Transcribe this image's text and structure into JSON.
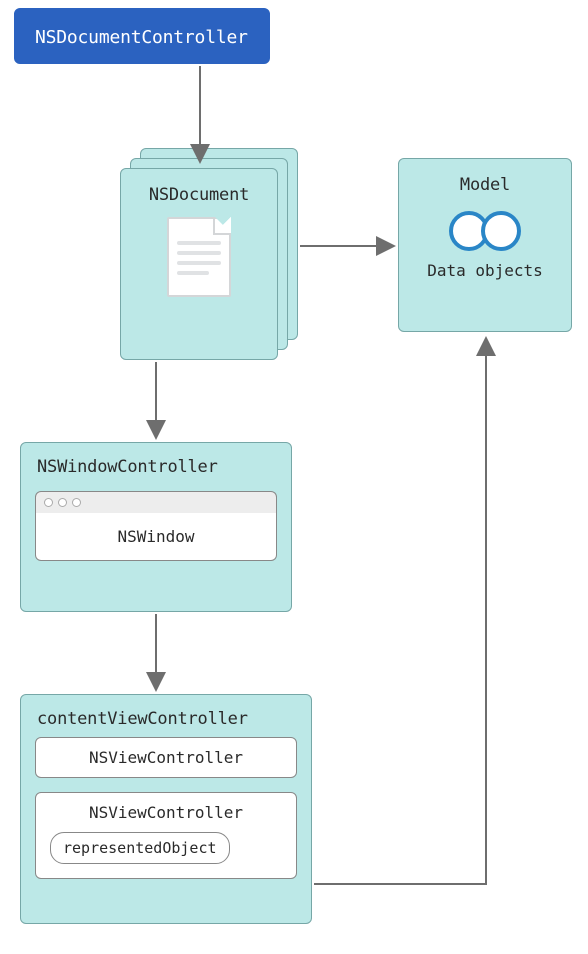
{
  "nodes": {
    "doc_controller": "NSDocumentController",
    "document": "NSDocument",
    "model_title": "Model",
    "model_caption": "Data objects",
    "window_controller": "NSWindowController",
    "window": "NSWindow",
    "content_vc": "contentViewController",
    "vc1": "NSViewController",
    "vc2": "NSViewController",
    "represented": "representedObject"
  }
}
